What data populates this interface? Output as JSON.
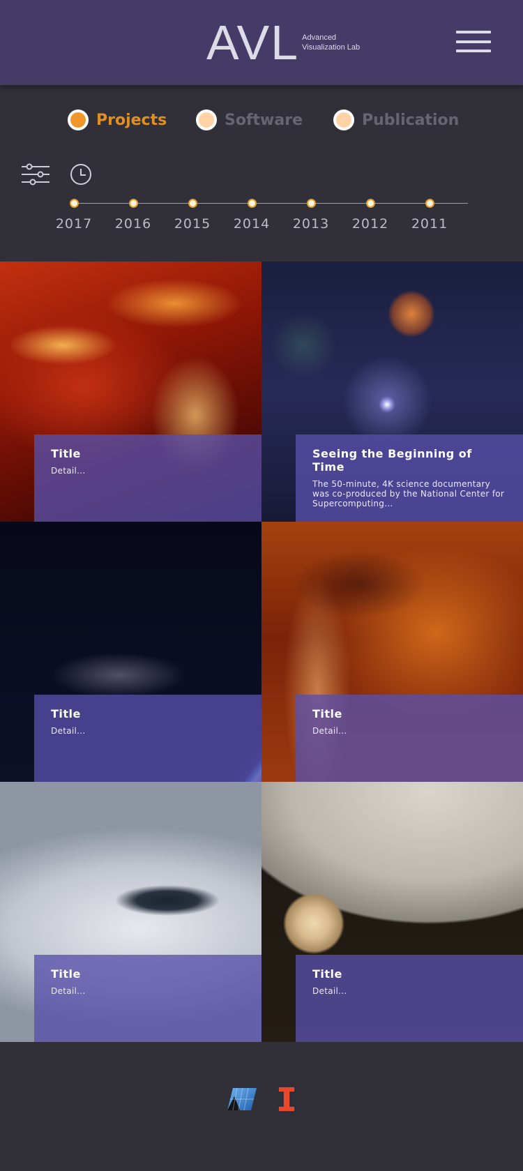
{
  "header": {
    "logo_mark": "AVL",
    "logo_line1": "Advanced",
    "logo_line2": "Visualization Lab"
  },
  "tabs": [
    {
      "label": "Projects",
      "active": true,
      "dot_color": "#f0962c",
      "text_color": "#e08f22"
    },
    {
      "label": "Software",
      "active": false,
      "dot_color": "#ffd3a6",
      "text_color": "#67656f"
    },
    {
      "label": "Publication",
      "active": false,
      "dot_color": "#ffd3a6",
      "text_color": "#67656f"
    }
  ],
  "timeline": {
    "years": [
      "2017",
      "2016",
      "2015",
      "2014",
      "2013",
      "2012",
      "2011"
    ]
  },
  "projects": [
    {
      "title": "Title",
      "detail": "Detail..."
    },
    {
      "title": "Seeing the Beginning of Time",
      "detail": "The 50-minute, 4K science documentary was co-produced by the National Center for Supercomputing..."
    },
    {
      "title": "Title",
      "detail": "Detail..."
    },
    {
      "title": "Title",
      "detail": "Detail..."
    },
    {
      "title": "Title",
      "detail": "Detail..."
    },
    {
      "title": "Title",
      "detail": "Detail..."
    }
  ],
  "colors": {
    "header_bg": "#453b66",
    "page_bg": "#313038",
    "accent": "#e08f22",
    "timeline_line": "#d99b26",
    "card_panel": "#5850aa"
  }
}
